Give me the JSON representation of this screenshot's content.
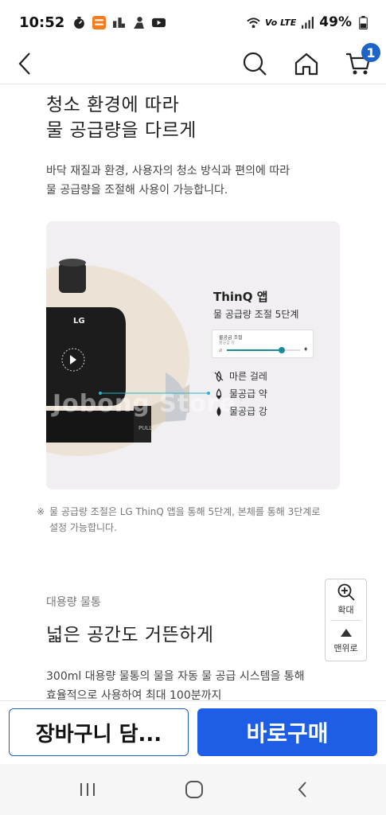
{
  "status_bar": {
    "time": "10:52",
    "network_label": "Vo LTE",
    "battery": "49%"
  },
  "header": {
    "cart_count": "1"
  },
  "section1": {
    "title_line1": "청소 환경에 따라",
    "title_line2": "물 공급량을 다르게",
    "desc_line1": "바닥 재질과 환경, 사용자의 청소 방식과 편의에 따라",
    "desc_line2": "물 공급량을 조절해 사용이 가능합니다."
  },
  "product_image": {
    "brand": "LG",
    "watermark": "Jobong Store",
    "app_title": "ThinQ 앱",
    "app_sub": "물 공급량 조절 5단계",
    "slider_title": "물공급 조절",
    "slider_sub": "물공급 강",
    "slider_level": 0.75,
    "device_label": "PULL",
    "modes": [
      "마른 걸레",
      "물공급 약",
      "물공급 강"
    ]
  },
  "note": {
    "mark": "※",
    "line1": "물 공급량 조절은 LG ThinQ 앱을 통해 5단계, 본체를 통해 3단계로",
    "line2": "설정 가능합니다."
  },
  "section2": {
    "label": "대용량 물통",
    "title": "넓은 공간도 거뜬하게",
    "desc_line1": "300ml 대용량 물통의 물을 자동 물 공급 시스템을 통해",
    "desc_line2": "효율적으로 사용하여 최대 100분까지"
  },
  "side_tools": {
    "zoom_label": "확대",
    "top_label": "맨위로"
  },
  "buy_bar": {
    "cart_label": "장바구니 담...",
    "buy_label": "바로구매"
  },
  "colors": {
    "accent": "#1e5ee6",
    "badge": "#1e63c7",
    "teal": "#1a8a9e",
    "panel_bg": "#f2eff3"
  }
}
